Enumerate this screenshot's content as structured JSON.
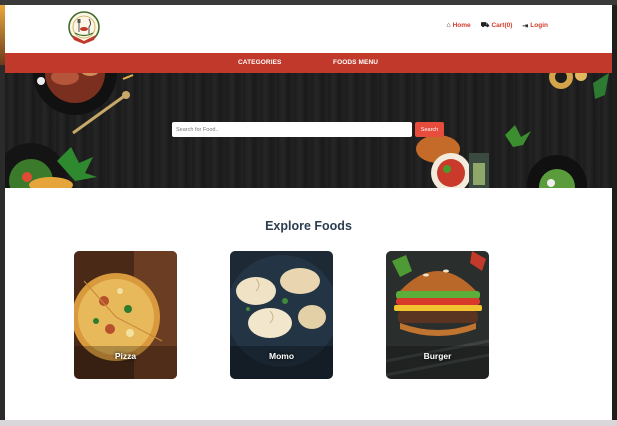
{
  "header": {
    "logo_icon": "restaurant-logo-icon",
    "nav": [
      {
        "label": "Home",
        "icon": "home-icon",
        "glyph": "⌂"
      },
      {
        "label": "Cart(0)",
        "icon": "cart-icon",
        "glyph": "⛟"
      },
      {
        "label": "Login",
        "icon": "login-icon",
        "glyph": "⇥"
      }
    ]
  },
  "menubar": {
    "items": [
      "CATEGORIES",
      "FOODS MENU"
    ],
    "color": "#c0392b"
  },
  "search": {
    "placeholder": "Search for Food..",
    "button_label": "Search",
    "button_color": "#e74c3c"
  },
  "explore": {
    "title": "Explore Foods",
    "categories": [
      {
        "label": "Pizza"
      },
      {
        "label": "Momo"
      },
      {
        "label": "Burger"
      }
    ]
  }
}
